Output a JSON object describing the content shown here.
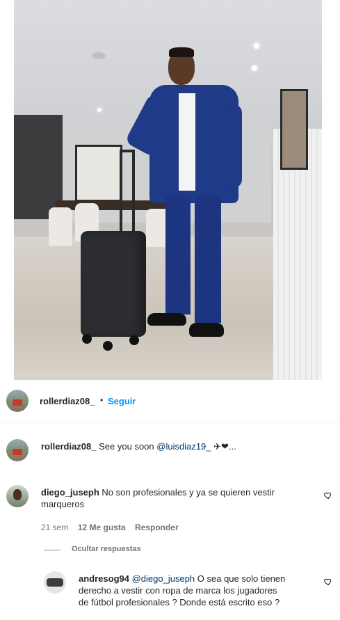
{
  "header": {
    "username": "rollerdiaz08_",
    "separator": "•",
    "follow_label": "Seguir"
  },
  "caption": {
    "username": "rollerdiaz08_",
    "text": "See you soon",
    "mention": "@luisdiaz19_",
    "emoji": "✈❤..."
  },
  "comments": [
    {
      "username": "diego_juseph",
      "text": "No son profesionales y ya se quieren vestir marqueros",
      "time": "21 sem",
      "likes": "12 Me gusta",
      "reply_label": "Responder"
    }
  ],
  "hide_replies_label": "Ocultar respuestas",
  "reply": {
    "username": "andresog94",
    "mention": "@diego_juseph",
    "text": "O sea que solo tienen derecho a vestir con ropa de marca los jugadores de fútbol profesionales ? Donde está escrito eso ?"
  },
  "colors": {
    "link_blue": "#0095f6",
    "mention_blue": "#00376b",
    "suit_blue": "#1f3a86"
  }
}
